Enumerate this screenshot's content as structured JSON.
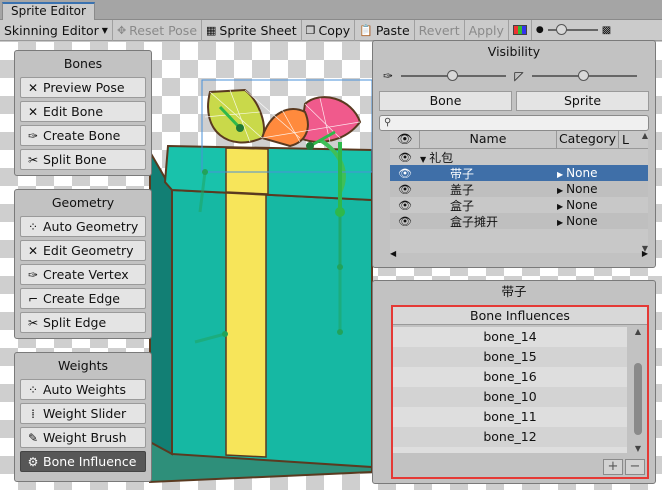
{
  "window": {
    "title": "Sprite Editor"
  },
  "toolbar": {
    "mode": "Skinning Editor",
    "reset_pose": "Reset Pose",
    "sprite_sheet": "Sprite Sheet",
    "copy": "Copy",
    "paste": "Paste",
    "revert": "Revert",
    "apply": "Apply"
  },
  "bones_panel": {
    "title": "Bones",
    "items": [
      {
        "label": "Preview Pose",
        "icon": "preview-pose-icon"
      },
      {
        "label": "Edit Bone",
        "icon": "edit-bone-icon"
      },
      {
        "label": "Create Bone",
        "icon": "create-bone-icon"
      },
      {
        "label": "Split Bone",
        "icon": "split-bone-icon"
      }
    ]
  },
  "geometry_panel": {
    "title": "Geometry",
    "items": [
      {
        "label": "Auto Geometry",
        "icon": "auto-geometry-icon"
      },
      {
        "label": "Edit Geometry",
        "icon": "edit-geometry-icon"
      },
      {
        "label": "Create Vertex",
        "icon": "create-vertex-icon"
      },
      {
        "label": "Create Edge",
        "icon": "create-edge-icon"
      },
      {
        "label": "Split Edge",
        "icon": "split-edge-icon"
      }
    ]
  },
  "weights_panel": {
    "title": "Weights",
    "items": [
      {
        "label": "Auto Weights",
        "icon": "auto-weights-icon"
      },
      {
        "label": "Weight Slider",
        "icon": "weight-slider-icon"
      },
      {
        "label": "Weight Brush",
        "icon": "weight-brush-icon"
      },
      {
        "label": "Bone Influence",
        "icon": "bone-influence-icon",
        "active": true
      }
    ]
  },
  "visibility": {
    "title": "Visibility",
    "tabs": [
      "Bone",
      "Sprite"
    ],
    "columns": {
      "name": "Name",
      "category": "Category",
      "extra": "L"
    },
    "rows": [
      {
        "name": "礼包",
        "category": "",
        "expanded": true
      },
      {
        "name": "带子",
        "category": "None",
        "selected": true
      },
      {
        "name": "盖子",
        "category": "None"
      },
      {
        "name": "盒子",
        "category": "None"
      },
      {
        "name": "盒子摊开",
        "category": "None"
      }
    ]
  },
  "bone_influence": {
    "selected_sprite": "带子",
    "header": "Bone Influences",
    "bones": [
      "bone_14",
      "bone_15",
      "bone_16",
      "bone_10",
      "bone_11",
      "bone_12"
    ],
    "add_label": "+",
    "remove_label": "−"
  },
  "colors": {
    "selection_blue": "#3f6fa8",
    "highlight_red": "#e53935",
    "box_teal": "#16b8a3",
    "ribbon_yellow": "#f7e55a",
    "bone_green": "#2fb84a"
  }
}
